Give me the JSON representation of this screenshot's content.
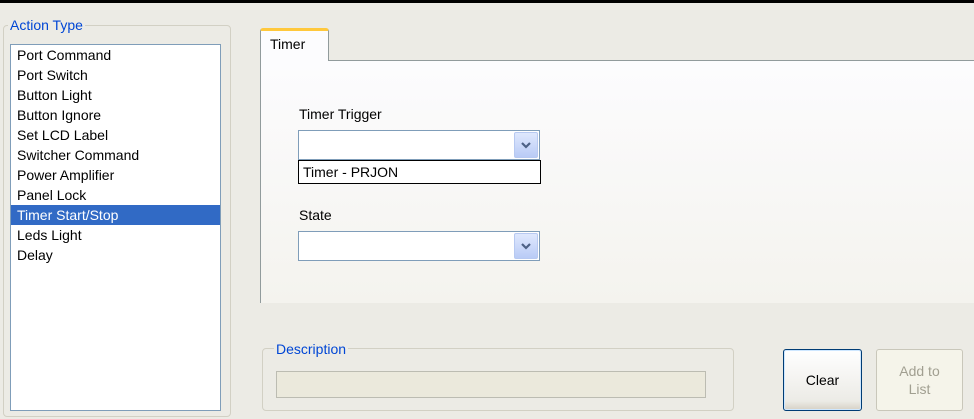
{
  "action_type": {
    "title": "Action Type",
    "items": [
      {
        "label": "Port Command",
        "selected": false
      },
      {
        "label": "Port Switch",
        "selected": false
      },
      {
        "label": "Button Light",
        "selected": false
      },
      {
        "label": "Button Ignore",
        "selected": false
      },
      {
        "label": "Set LCD Label",
        "selected": false
      },
      {
        "label": "Switcher Command",
        "selected": false
      },
      {
        "label": "Power Amplifier",
        "selected": false
      },
      {
        "label": "Panel Lock",
        "selected": false
      },
      {
        "label": "Timer Start/Stop",
        "selected": true
      },
      {
        "label": "Leds Light",
        "selected": false
      },
      {
        "label": "Delay",
        "selected": false
      }
    ]
  },
  "tab": {
    "label": "Timer",
    "timer_trigger": {
      "label": "Timer Trigger",
      "value": "",
      "options": [
        "Timer - PRJON"
      ]
    },
    "state": {
      "label": "State",
      "value": ""
    }
  },
  "description": {
    "title": "Description",
    "value": ""
  },
  "buttons": {
    "clear": "Clear",
    "add_to_list": "Add to\nList"
  },
  "icons": {
    "dropdown_arrow": "chevron-down-icon"
  },
  "colors": {
    "selection": "#316ac5",
    "group_title": "#0046d5",
    "tab_accent": "#ffc83c"
  }
}
